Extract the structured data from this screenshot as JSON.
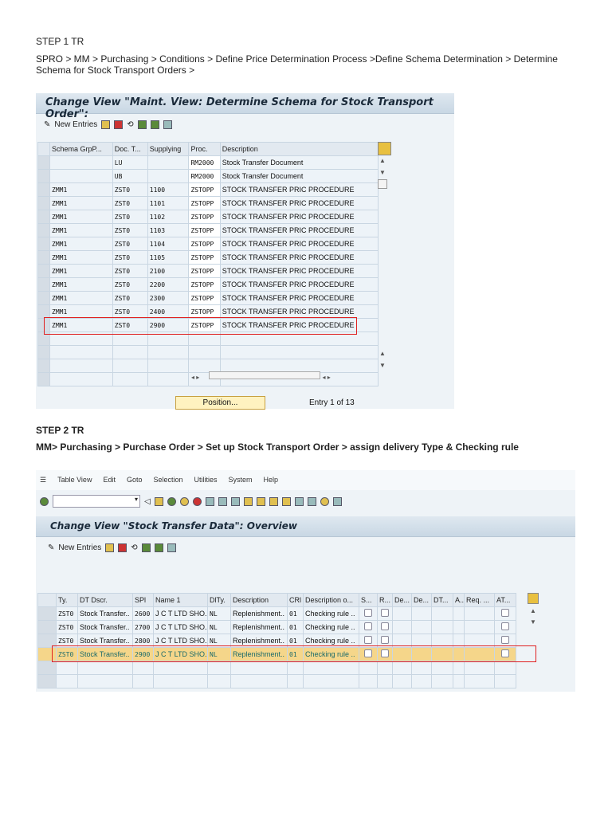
{
  "step1": {
    "heading": "STEP 1  TR",
    "path": "SPRO > MM > Purchasing > Conditions > Define Price Determination Process >Define Schema Determination > Determine Schema for Stock Transport Orders >"
  },
  "screen1": {
    "title": "Change View \"Maint. View: Determine Schema for Stock Transport Order\":",
    "toolbar": {
      "new_entries": "New Entries"
    },
    "columns": [
      "Schema GrpP...",
      "Doc. T...",
      "Supplying",
      "Proc.",
      "Description"
    ],
    "rows": [
      [
        "",
        "LU",
        "",
        "RM2000",
        "Stock Transfer Document"
      ],
      [
        "",
        "UB",
        "",
        "RM2000",
        "Stock Transfer Document"
      ],
      [
        "ZMM1",
        "ZST0",
        "1100",
        "ZSTOPP",
        "STOCK TRANSFER PRIC PROCEDURE"
      ],
      [
        "ZMM1",
        "ZST0",
        "1101",
        "ZSTOPP",
        "STOCK TRANSFER PRIC PROCEDURE"
      ],
      [
        "ZMM1",
        "ZST0",
        "1102",
        "ZSTOPP",
        "STOCK TRANSFER PRIC PROCEDURE"
      ],
      [
        "ZMM1",
        "ZST0",
        "1103",
        "ZSTOPP",
        "STOCK TRANSFER PRIC PROCEDURE"
      ],
      [
        "ZMM1",
        "ZST0",
        "1104",
        "ZSTOPP",
        "STOCK TRANSFER PRIC PROCEDURE"
      ],
      [
        "ZMM1",
        "ZST0",
        "1105",
        "ZSTOPP",
        "STOCK TRANSFER PRIC PROCEDURE"
      ],
      [
        "ZMM1",
        "ZST0",
        "2100",
        "ZSTOPP",
        "STOCK TRANSFER PRIC PROCEDURE"
      ],
      [
        "ZMM1",
        "ZST0",
        "2200",
        "ZSTOPP",
        "STOCK TRANSFER PRIC PROCEDURE"
      ],
      [
        "ZMM1",
        "ZST0",
        "2300",
        "ZSTOPP",
        "STOCK TRANSFER PRIC PROCEDURE"
      ],
      [
        "ZMM1",
        "ZST0",
        "2400",
        "ZSTOPP",
        "STOCK TRANSFER PRIC PROCEDURE"
      ],
      [
        "ZMM1",
        "ZST0",
        "2900",
        "ZSTOPP",
        "STOCK TRANSFER PRIC PROCEDURE"
      ]
    ],
    "position_label": "Position...",
    "entry_info": "Entry 1 of 13"
  },
  "step2": {
    "heading": "STEP 2  TR",
    "path": "MM> Purchasing > Purchase Order > Set up Stock Transport Order > assign delivery Type & Checking rule"
  },
  "screen2": {
    "menu": [
      "Table View",
      "Edit",
      "Goto",
      "Selection",
      "Utilities",
      "System",
      "Help"
    ],
    "command_field": "",
    "title": "Change View \"Stock Transfer Data\": Overview",
    "toolbar": {
      "new_entries": "New Entries"
    },
    "columns": [
      "Ty.",
      "DT Dscr.",
      "SPl",
      "Name 1",
      "DlTy.",
      "Description",
      "CRl",
      "Description o...",
      "S...",
      "R...",
      "De...",
      "De...",
      "DT...",
      "A...",
      "Req. ...",
      "AT..."
    ],
    "rows": [
      [
        "ZST0",
        "Stock Transfer..",
        "2600",
        "J C T LTD SHO..",
        "NL",
        "Replenishment..",
        "01",
        "Checking rule .."
      ],
      [
        "ZST0",
        "Stock Transfer..",
        "2700",
        "J C T LTD SHO..",
        "NL",
        "Replenishment..",
        "01",
        "Checking rule .."
      ],
      [
        "ZST0",
        "Stock Transfer..",
        "2800",
        "J C T LTD SHO..",
        "NL",
        "Replenishment..",
        "01",
        "Checking rule .."
      ],
      [
        "ZST0",
        "Stock Transfer..",
        "2900",
        "J C T LTD SHO..",
        "NL",
        "Replenishment..",
        "01",
        "Checking rule .."
      ]
    ]
  },
  "colors": {
    "highlight": "#f5d68a",
    "red_box": "#e02020",
    "screen_bg": "#eef3f7"
  }
}
